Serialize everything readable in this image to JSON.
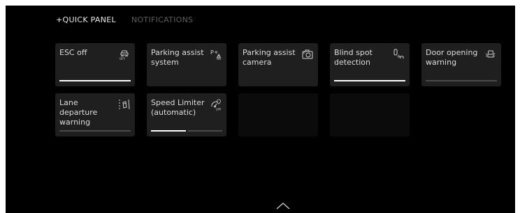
{
  "tabs": {
    "quick_panel": "+QUICK PANEL",
    "notifications": "NOTIFICATIONS"
  },
  "tiles": [
    {
      "label": "ESC off",
      "icon": "esc-off-icon",
      "segments": 1,
      "active_segment": 1
    },
    {
      "label": "Parking assist system",
      "icon": "parking-assist-icon",
      "segments": 0,
      "active_segment": 0
    },
    {
      "label": "Parking assist camera",
      "icon": "camera-icon",
      "segments": 0,
      "active_segment": 0
    },
    {
      "label": "Blind spot detection",
      "icon": "blind-spot-icon",
      "segments": 1,
      "active_segment": 1
    },
    {
      "label": "Door opening warning",
      "icon": "door-warning-icon",
      "segments": 1,
      "active_segment": 0
    },
    {
      "label": "Lane departure warning",
      "icon": "lane-departure-icon",
      "segments": 1,
      "active_segment": 0
    },
    {
      "label": "Speed Limiter (automatic)",
      "icon": "speed-limiter-icon",
      "segments": 2,
      "active_segment": 1
    }
  ],
  "colors": {
    "background": "#000000",
    "tile": "#1f1f1f",
    "active_bar": "#ffffff",
    "inactive_bar": "#4a4a4a"
  }
}
